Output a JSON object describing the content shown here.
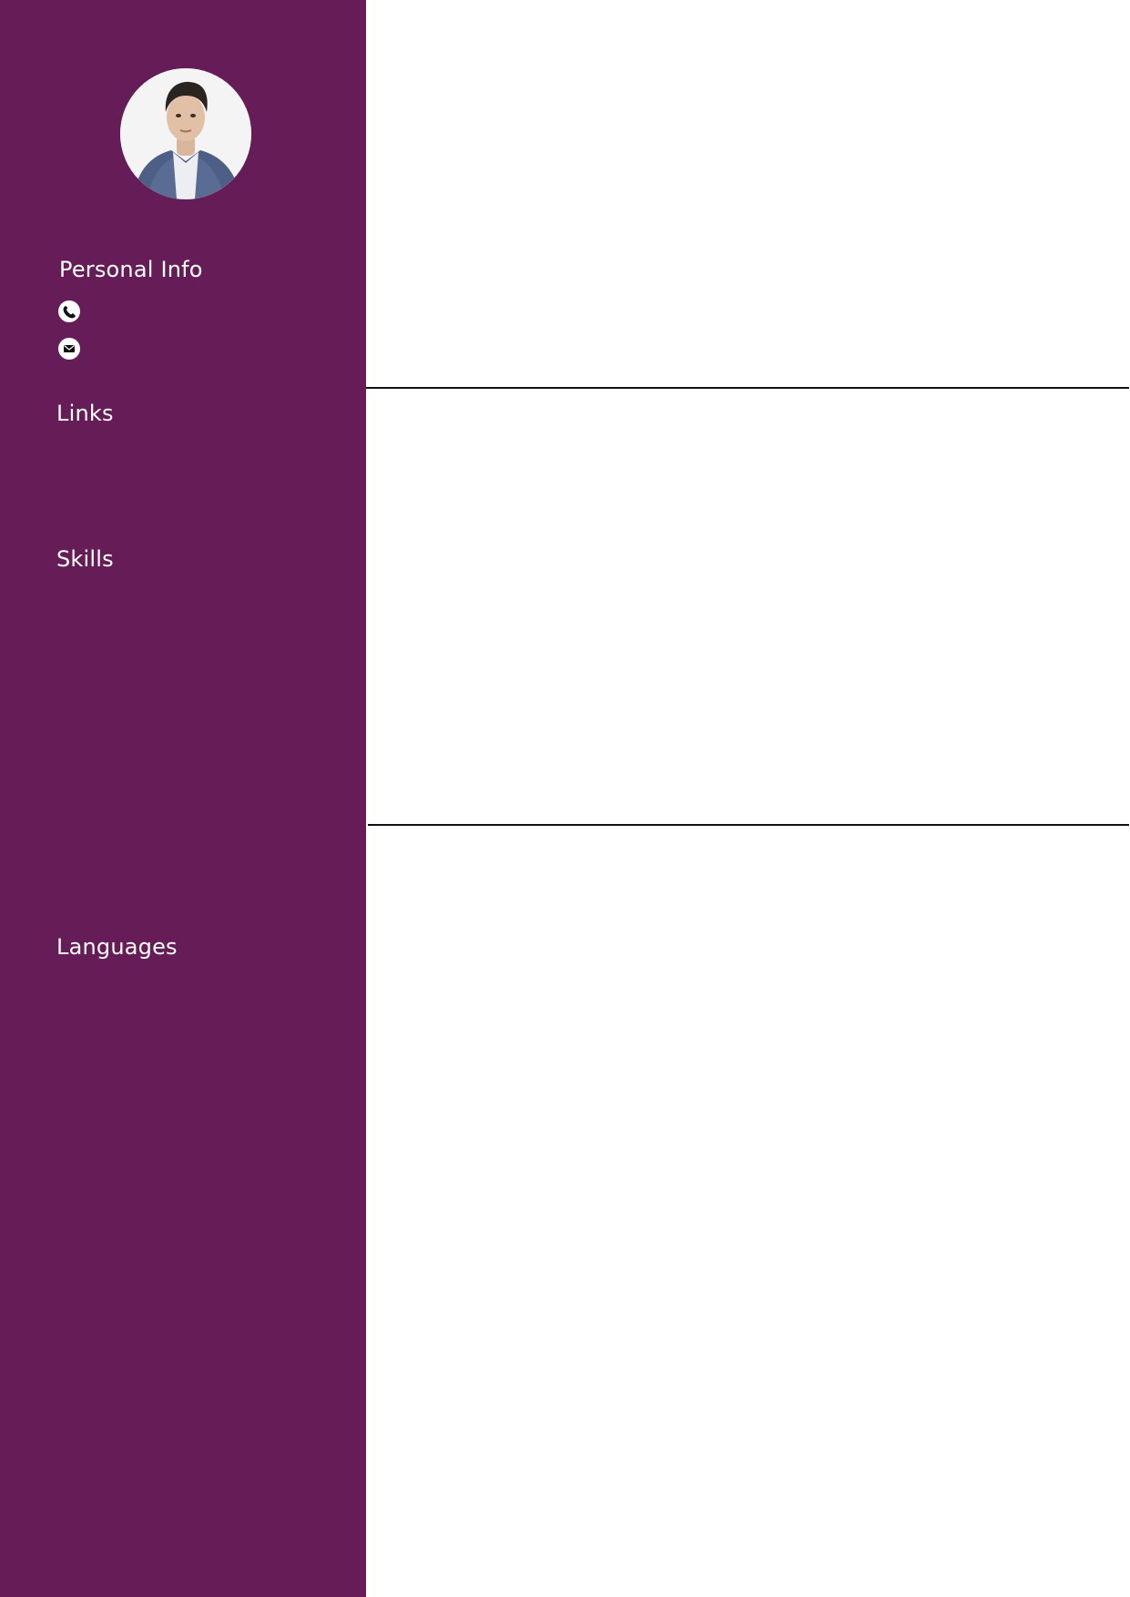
{
  "sidebar": {
    "background": "#661c56",
    "photo": {
      "alt": "",
      "icon": "profile-photo"
    },
    "sections": {
      "personal_info": "Personal Info",
      "links": "Links",
      "skills": "Skills",
      "languages": "Languages"
    },
    "contact_icons": [
      "phone-icon",
      "mail-icon"
    ]
  },
  "colors": {
    "accent": "#661c56",
    "text_on_accent": "#ffffff",
    "rule": "#111111"
  }
}
